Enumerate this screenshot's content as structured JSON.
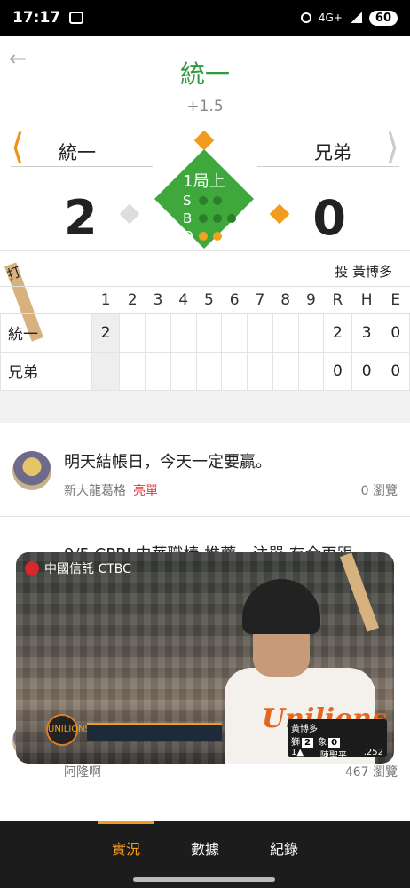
{
  "status_bar": {
    "time": "17:17",
    "network": "4G+",
    "battery": "60"
  },
  "header": {
    "title": "統一",
    "odds": "+1.5"
  },
  "scoreboard": {
    "away_team": "統一",
    "home_team": "兄弟",
    "away_score": "2",
    "home_score": "0",
    "inning": "1局上",
    "count_labels": [
      "S",
      "B",
      "O"
    ],
    "strikes": 0,
    "balls": 0,
    "outs": 2
  },
  "matchup": {
    "batter_label": "打",
    "pitcher_label": "投",
    "pitcher": "黃博多"
  },
  "linescore": {
    "headers": [
      "1",
      "2",
      "3",
      "4",
      "5",
      "6",
      "7",
      "8",
      "9",
      "R",
      "H",
      "E"
    ],
    "rows": [
      {
        "team": "統一",
        "innings": [
          "2",
          "",
          "",
          "",
          "",
          "",
          "",
          "",
          ""
        ],
        "r": "2",
        "h": "3",
        "e": "0"
      },
      {
        "team": "兄弟",
        "innings": [
          "",
          "",
          "",
          "",
          "",
          "",
          "",
          "",
          ""
        ],
        "r": "0",
        "h": "0",
        "e": "0"
      }
    ]
  },
  "posts": [
    {
      "text": "明天結帳日，今天一定要贏。",
      "author": "新大龍葛格",
      "tag": "亮單",
      "views": "0 瀏覽"
    },
    {
      "text": "9/5 CPBL中華職棒 推薦一注單 有全再跟",
      "author": "阿隆啊",
      "views": "467 瀏覽"
    }
  ],
  "video": {
    "sponsor": "中國信託 CTBC",
    "team_badge": "UNILIONS",
    "jersey_text": "Unilions",
    "mini_scoreboard": {
      "pitcher": "黃博多",
      "away": "獅",
      "away_score": "2",
      "home": "象",
      "home_score": "0",
      "batter": "陳聖平",
      "avg": ".252",
      "inning": "1▲"
    }
  },
  "tabs": [
    "實況",
    "數據",
    "紀錄"
  ],
  "active_tab": 0
}
